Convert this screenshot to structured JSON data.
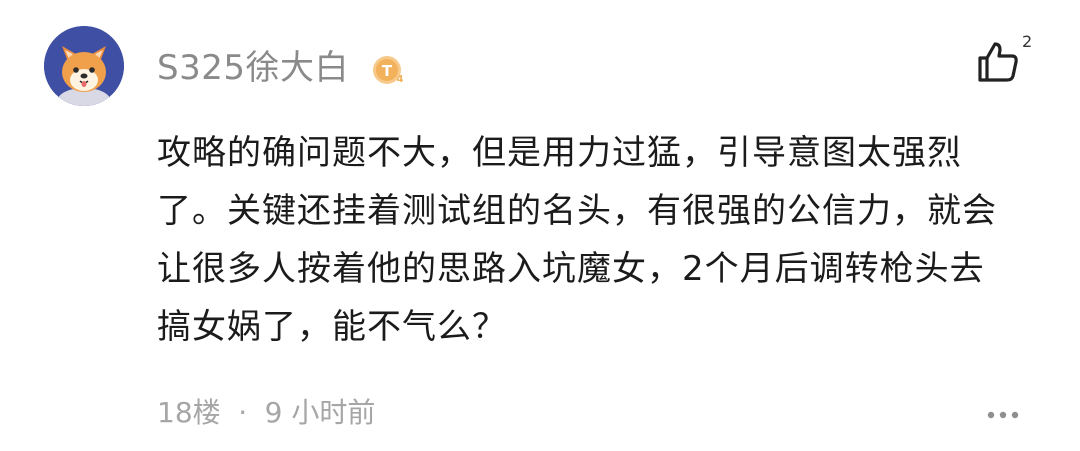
{
  "comment": {
    "username": "S325徐大白",
    "level_badge": "T4",
    "like_count": "2",
    "body_lines": [
      "攻略的确问题不大，但是用力过猛，引导意图太强烈",
      "了。关键还挂着测试组的名头，有很强的公信力，就会",
      "让很多人按着他的思路入坑魔女，2个月后调转枪头去",
      "搞女娲了，能不气么？"
    ],
    "floor": "18楼",
    "separator": "·",
    "time": "9 小时前"
  },
  "icons": {
    "avatar": "shiba-dog-avatar",
    "level": "level-badge-icon",
    "like": "thumbs-up-icon",
    "more": "more-dots-icon"
  },
  "colors": {
    "username": "#8a8a8a",
    "body_text": "#1b1b1b",
    "meta_text": "#a6a6a6",
    "avatar_bg": "#3f4fa3",
    "badge": "#f2b25c"
  }
}
